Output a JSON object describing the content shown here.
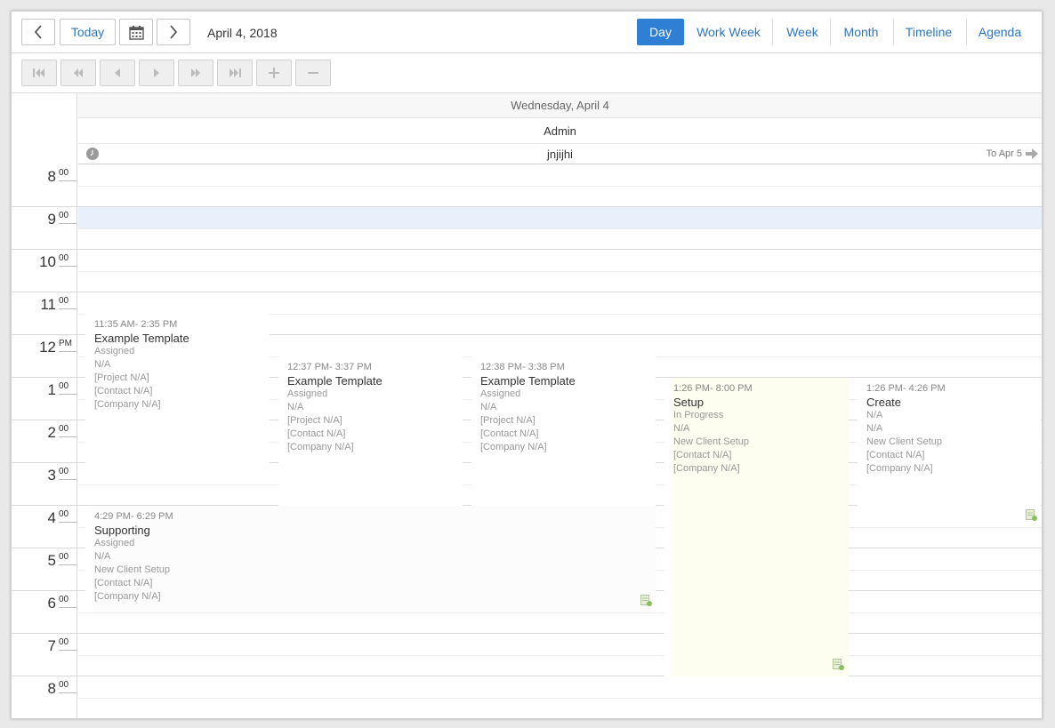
{
  "toolbar": {
    "today_label": "Today",
    "date_label": "April 4, 2018",
    "views": [
      {
        "label": "Day"
      },
      {
        "label": "Work Week"
      },
      {
        "label": "Week"
      },
      {
        "label": "Month"
      },
      {
        "label": "Timeline"
      },
      {
        "label": "Agenda"
      }
    ]
  },
  "header": {
    "day": "Wednesday, April 4",
    "resource": "Admin",
    "allday_event": "jnjijhi",
    "allday_continue": "To Apr 5"
  },
  "hours": [
    {
      "num": "8",
      "sup": "00"
    },
    {
      "num": "9",
      "sup": "00"
    },
    {
      "num": "10",
      "sup": "00"
    },
    {
      "num": "11",
      "sup": "00"
    },
    {
      "num": "12",
      "sup": "PM"
    },
    {
      "num": "1",
      "sup": "00"
    },
    {
      "num": "2",
      "sup": "00"
    },
    {
      "num": "3",
      "sup": "00"
    },
    {
      "num": "4",
      "sup": "00"
    },
    {
      "num": "5",
      "sup": "00"
    },
    {
      "num": "6",
      "sup": "00"
    },
    {
      "num": "7",
      "sup": "00"
    },
    {
      "num": "8",
      "sup": "00"
    }
  ],
  "events": [
    {
      "time": "11:35 AM- 2:35 PM",
      "title": "Example Template",
      "lines": [
        "Assigned",
        "N/A",
        "[Project N/A]",
        "[Contact N/A]",
        "[Company N/A]"
      ]
    },
    {
      "time": "12:37 PM- 3:37 PM",
      "title": "Example Template",
      "lines": [
        "Assigned",
        "N/A",
        "[Project N/A]",
        "[Contact N/A]",
        "[Company N/A]"
      ]
    },
    {
      "time": "12:38 PM- 3:38 PM",
      "title": "Example Template",
      "lines": [
        "Assigned",
        "N/A",
        "[Project N/A]",
        "[Contact N/A]",
        "[Company N/A]"
      ]
    },
    {
      "time": "1:26 PM- 8:00 PM",
      "title": "Setup",
      "lines": [
        "In Progress",
        "N/A",
        "New Client Setup",
        "[Contact N/A]",
        "[Company N/A]"
      ]
    },
    {
      "time": "1:26 PM- 4:26 PM",
      "title": "Create",
      "lines": [
        "N/A",
        "N/A",
        "New Client Setup",
        "[Contact N/A]",
        "[Company N/A]"
      ]
    },
    {
      "time": "4:29 PM- 6:29 PM",
      "title": "Supporting",
      "lines": [
        "Assigned",
        "N/A",
        "New Client Setup",
        "[Contact N/A]",
        "[Company N/A]"
      ]
    }
  ],
  "colors": {
    "accent": "#2f7fd4",
    "current_hour_highlight": "#e8f1fb",
    "setup_event_bg": "#fdfdf0",
    "note_icon": "#c5d9a8"
  },
  "icons": {
    "prev": "chevron-left-icon",
    "next": "chevron-right-icon",
    "calendar": "calendar-icon",
    "note": "note-add-icon",
    "clock": "clock-icon",
    "arrow_right": "arrow-right-icon"
  }
}
